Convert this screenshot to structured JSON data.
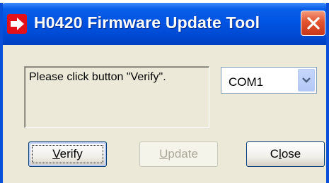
{
  "window": {
    "title": "H0420 Firmware Update Tool",
    "icon": "red-arrow-icon",
    "close_icon": "close-icon"
  },
  "status": {
    "message": "Please click button \"Verify\"."
  },
  "port_select": {
    "selected": "COM1"
  },
  "buttons": {
    "verify": {
      "first": "V",
      "rest": "erify",
      "enabled": true,
      "focused": true
    },
    "update": {
      "first": "U",
      "rest": "pdate",
      "enabled": false
    },
    "close": {
      "prefix": "C",
      "mnemonic": "l",
      "rest": "ose",
      "enabled": true
    }
  },
  "colors": {
    "titlebar": "#0054e3",
    "window_bg": "#ece9d8",
    "close_button": "#e2522d",
    "disabled_text": "#aca899"
  }
}
